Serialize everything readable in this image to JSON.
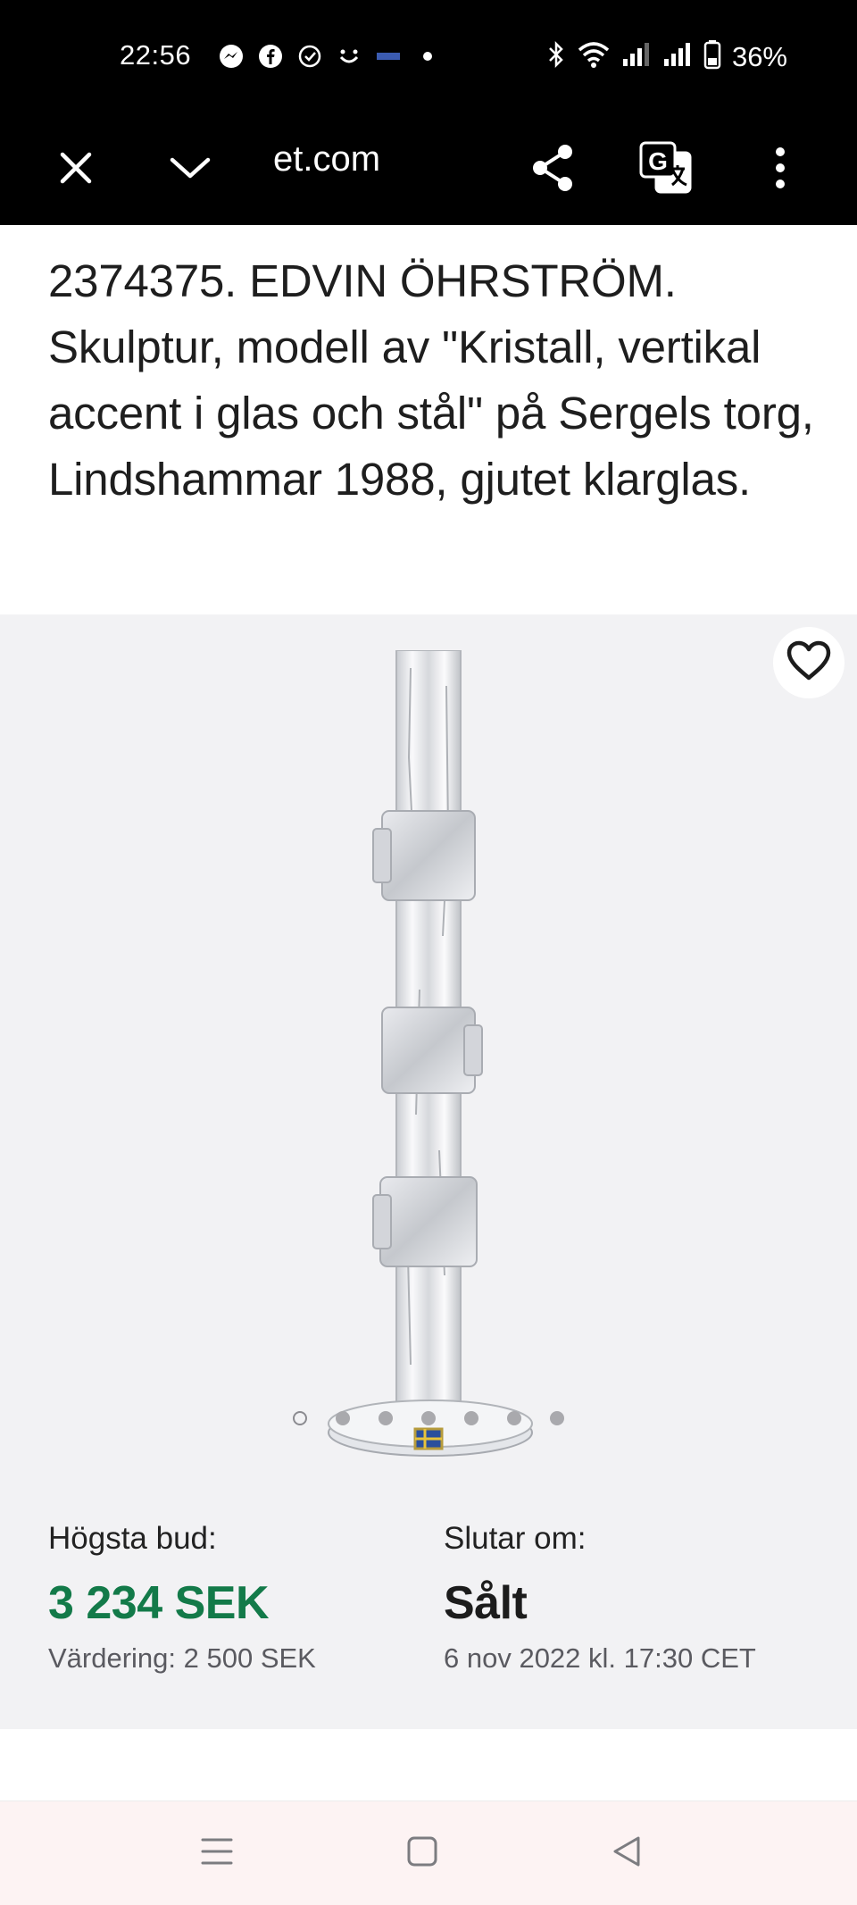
{
  "status_bar": {
    "time": "22:56",
    "notification_icons": [
      "messenger-icon",
      "facebook-icon",
      "check-circle-icon",
      "smile-icon",
      "sinb-icon",
      "dot-icon"
    ],
    "battery": "36%"
  },
  "toolbar": {
    "url": "et.com"
  },
  "listing": {
    "title": "2374375. EDVIN ÖHRSTRÖM. Skulptur, modell av \"Kristall, vertikal accent i glas och stål\" på Sergels torg, Lindshammar 1988, gjutet klarglas."
  },
  "gallery": {
    "image_count": 7,
    "active_index": 0
  },
  "bid": {
    "label": "Högsta bud:",
    "amount": "3 234 SEK",
    "estimate": "Värdering: 2 500 SEK"
  },
  "ending": {
    "label": "Slutar om:",
    "status": "Sålt",
    "date": "6 nov 2022 kl. 17:30 CET"
  },
  "colors": {
    "accent_green": "#137a49",
    "gallery_bg": "#f2f2f4"
  }
}
